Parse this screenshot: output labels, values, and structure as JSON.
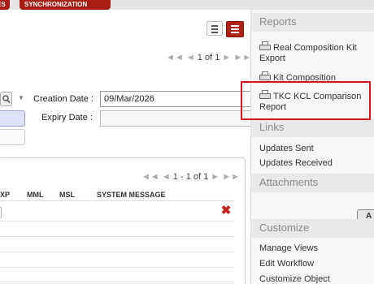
{
  "topbar": {
    "tab_prev": "ES",
    "tab_sync": "SYNCHRONIZATION"
  },
  "main": {
    "top_pager": {
      "first": "◄◄",
      "prev": "◄",
      "page": "1 of 1",
      "next": "►",
      "last": "►►"
    },
    "filters": {
      "creation_label": "Creation Date :",
      "creation_value": "09/Mar/2026",
      "expiry_label": "Expiry Date :",
      "expiry_value": ""
    },
    "grid": {
      "pager": {
        "first": "◄◄",
        "prev": "◄",
        "range": "1 - 1 of 1",
        "next": "►",
        "last": "►►"
      },
      "columns": [
        "XP",
        "MML",
        "MSL",
        "SYSTEM MESSAGE"
      ]
    }
  },
  "sidebar": {
    "reports_title": "Reports",
    "reports": [
      "Real Composition Kit Export",
      "Kit Composition",
      "TKC KCL Comparison Report"
    ],
    "links_title": "Links",
    "links": [
      "Updates Sent",
      "Updates Received"
    ],
    "attachments_title": "Attachments",
    "attachments_add": "A",
    "customize_title": "Customize",
    "customize": [
      "Manage Views",
      "Edit Workflow",
      "Customize Object"
    ]
  },
  "colors": {
    "brand_red": "#a81d12",
    "highlight": "#d4151b",
    "delete_red": "#c0241a"
  }
}
